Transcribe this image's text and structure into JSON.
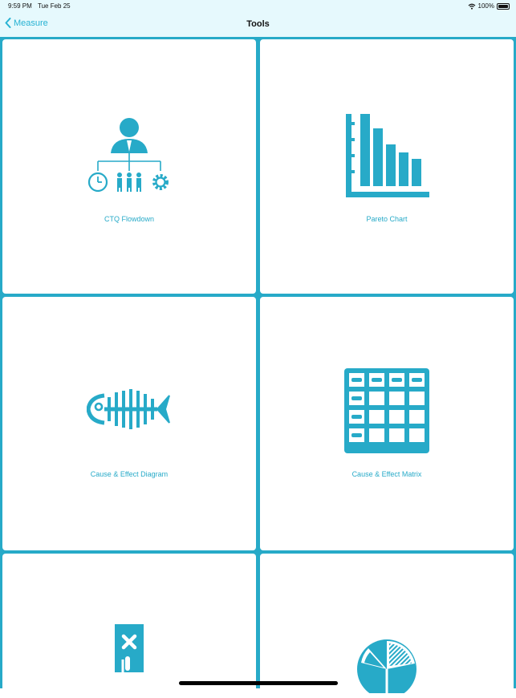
{
  "status": {
    "time": "9:59 PM",
    "date": "Tue Feb 25",
    "battery": "100%"
  },
  "nav": {
    "back_label": "Measure",
    "title": "Tools"
  },
  "tools": [
    {
      "label": "CTQ Flowdown",
      "icon": "org-chart-icon"
    },
    {
      "label": "Pareto Chart",
      "icon": "bar-chart-icon"
    },
    {
      "label": "Cause & Effect Diagram",
      "icon": "fishbone-icon"
    },
    {
      "label": "Cause & Effect Matrix",
      "icon": "matrix-icon"
    },
    {
      "label": "",
      "icon": "mistake-proofing-icon"
    },
    {
      "label": "",
      "icon": "pie-chart-icon"
    }
  ],
  "colors": {
    "accent": "#27aac8",
    "nav_bg": "#e6f9fd"
  }
}
